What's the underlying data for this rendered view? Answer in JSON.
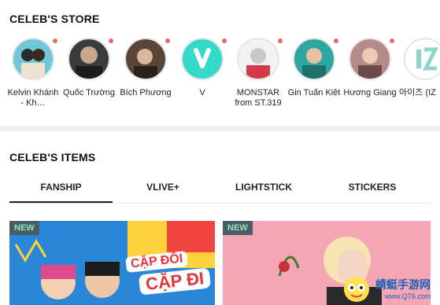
{
  "store": {
    "title": "CELEB'S STORE",
    "items": [
      {
        "name": "Kelvin Khánh - Kh…",
        "color": "#6fc7d8"
      },
      {
        "name": "Quốc Trường",
        "color": "#3b3b3b"
      },
      {
        "name": "Bích Phương",
        "color": "#5a4638"
      },
      {
        "name": "V",
        "color": "#34d9c9"
      },
      {
        "name": "MONSTAR from ST.319",
        "color": "#d53a4b"
      },
      {
        "name": "Gin Tuấn Kiệt",
        "color": "#2ea6a0"
      },
      {
        "name": "Hương Giang",
        "color": "#b48a8a"
      },
      {
        "name": "아이즈 (IZ",
        "color": "#b5e6d6"
      }
    ]
  },
  "items": {
    "title": "CELEB'S ITEMS",
    "tabs": [
      {
        "label": "FANSHIP",
        "active": true
      },
      {
        "label": "VLIVE+",
        "active": false
      },
      {
        "label": "LIGHTSTICK",
        "active": false
      },
      {
        "label": "STICKERS",
        "active": false
      }
    ],
    "cards": [
      {
        "badge": "NEW",
        "line1": "CẶP ĐÔI",
        "line2": "CẶP ĐI"
      },
      {
        "badge": "NEW"
      }
    ]
  },
  "watermark": {
    "title": "蜻蜓手游网",
    "url": "www.QT6.com"
  }
}
